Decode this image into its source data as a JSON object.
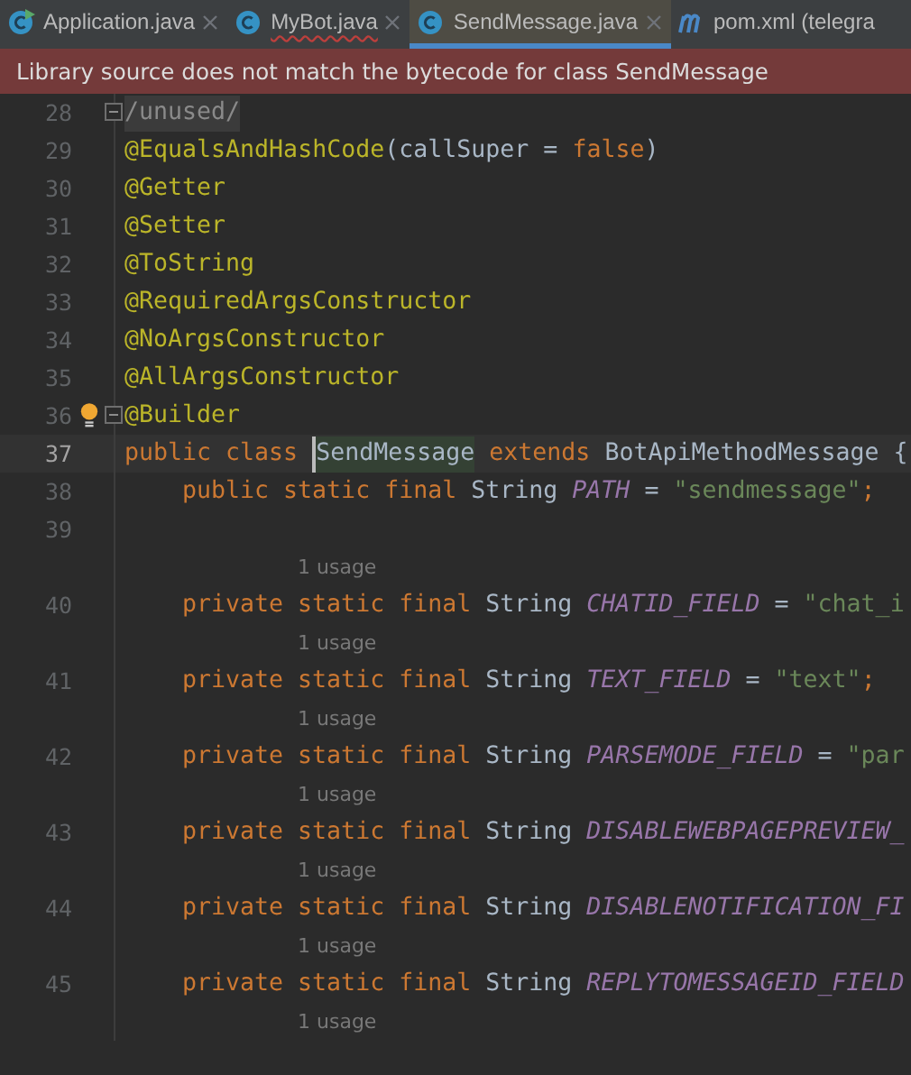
{
  "tabs": [
    {
      "label": "Application.java",
      "kind": "run",
      "selected": false,
      "closable": true,
      "error": false
    },
    {
      "label": "MyBot.java",
      "kind": "class",
      "selected": false,
      "closable": true,
      "error": true
    },
    {
      "label": "SendMessage.java",
      "kind": "class",
      "selected": true,
      "closable": true,
      "error": false
    },
    {
      "label": "pom.xml (telegra",
      "kind": "maven",
      "selected": false,
      "closable": false,
      "error": false
    }
  ],
  "banner": {
    "text": "Library source does not match the bytecode for class SendMessage"
  },
  "lines": [
    {
      "kind": "code",
      "number": "28",
      "current": false,
      "fold": true,
      "bulb": false,
      "indented": false,
      "tokens": [
        {
          "kind": "folded",
          "t": "/unused/"
        }
      ]
    },
    {
      "kind": "code",
      "number": "29",
      "current": false,
      "fold": false,
      "bulb": false,
      "indented": false,
      "tokens": [
        {
          "kind": "annotation",
          "t": "@EqualsAndHashCode"
        },
        {
          "kind": "plain",
          "t": "(callSuper = "
        },
        {
          "kind": "keyword",
          "t": "false"
        },
        {
          "kind": "plain",
          "t": ")"
        }
      ]
    },
    {
      "kind": "code",
      "number": "30",
      "current": false,
      "fold": false,
      "bulb": false,
      "indented": false,
      "tokens": [
        {
          "kind": "annotation",
          "t": "@Getter"
        }
      ]
    },
    {
      "kind": "code",
      "number": "31",
      "current": false,
      "fold": false,
      "bulb": false,
      "indented": false,
      "tokens": [
        {
          "kind": "annotation",
          "t": "@Setter"
        }
      ]
    },
    {
      "kind": "code",
      "number": "32",
      "current": false,
      "fold": false,
      "bulb": false,
      "indented": false,
      "tokens": [
        {
          "kind": "annotation",
          "t": "@ToString"
        }
      ]
    },
    {
      "kind": "code",
      "number": "33",
      "current": false,
      "fold": false,
      "bulb": false,
      "indented": false,
      "tokens": [
        {
          "kind": "annotation",
          "t": "@RequiredArgsConstructor"
        }
      ]
    },
    {
      "kind": "code",
      "number": "34",
      "current": false,
      "fold": false,
      "bulb": false,
      "indented": false,
      "tokens": [
        {
          "kind": "annotation",
          "t": "@NoArgsConstructor"
        }
      ]
    },
    {
      "kind": "code",
      "number": "35",
      "current": false,
      "fold": false,
      "bulb": false,
      "indented": false,
      "tokens": [
        {
          "kind": "annotation",
          "t": "@AllArgsConstructor"
        }
      ]
    },
    {
      "kind": "code",
      "number": "36",
      "current": false,
      "fold": true,
      "bulb": true,
      "indented": false,
      "tokens": [
        {
          "kind": "annotation",
          "t": "@Builder"
        }
      ]
    },
    {
      "kind": "code",
      "number": "37",
      "current": true,
      "fold": false,
      "bulb": false,
      "indented": false,
      "tokens": [
        {
          "kind": "keyword",
          "t": "public class "
        },
        {
          "kind": "plain",
          "t": "SendMessage",
          "highlight": true,
          "caret": true
        },
        {
          "kind": "keyword",
          "t": " extends "
        },
        {
          "kind": "plain",
          "t": "BotApiMethodMessage {"
        }
      ]
    },
    {
      "kind": "code",
      "number": "38",
      "current": false,
      "fold": false,
      "bulb": false,
      "indented": true,
      "tokens": [
        {
          "kind": "keyword",
          "t": "public static final "
        },
        {
          "kind": "plain",
          "t": "String "
        },
        {
          "kind": "constant",
          "t": "PATH"
        },
        {
          "kind": "plain",
          "t": " = "
        },
        {
          "kind": "string",
          "t": "\"sendmessage\""
        },
        {
          "kind": "keyword",
          "t": ";"
        }
      ]
    },
    {
      "kind": "code",
      "number": "39",
      "current": false,
      "fold": false,
      "bulb": false
    },
    {
      "kind": "hint",
      "text": "1 usage"
    },
    {
      "kind": "code",
      "number": "40",
      "current": false,
      "fold": false,
      "bulb": false,
      "indented": true,
      "tokens": [
        {
          "kind": "keyword",
          "t": "private static final "
        },
        {
          "kind": "plain",
          "t": "String "
        },
        {
          "kind": "constant",
          "t": "CHATID_FIELD"
        },
        {
          "kind": "plain",
          "t": " = "
        },
        {
          "kind": "string",
          "t": "\"chat_i"
        }
      ]
    },
    {
      "kind": "hint",
      "text": "1 usage"
    },
    {
      "kind": "code",
      "number": "41",
      "current": false,
      "fold": false,
      "bulb": false,
      "indented": true,
      "tokens": [
        {
          "kind": "keyword",
          "t": "private static final "
        },
        {
          "kind": "plain",
          "t": "String "
        },
        {
          "kind": "constant",
          "t": "TEXT_FIELD"
        },
        {
          "kind": "plain",
          "t": " = "
        },
        {
          "kind": "string",
          "t": "\"text\""
        },
        {
          "kind": "keyword",
          "t": ";"
        }
      ]
    },
    {
      "kind": "hint",
      "text": "1 usage"
    },
    {
      "kind": "code",
      "number": "42",
      "current": false,
      "fold": false,
      "bulb": false,
      "indented": true,
      "tokens": [
        {
          "kind": "keyword",
          "t": "private static final "
        },
        {
          "kind": "plain",
          "t": "String "
        },
        {
          "kind": "constant",
          "t": "PARSEMODE_FIELD"
        },
        {
          "kind": "plain",
          "t": " = "
        },
        {
          "kind": "string",
          "t": "\"par"
        }
      ]
    },
    {
      "kind": "hint",
      "text": "1 usage"
    },
    {
      "kind": "code",
      "number": "43",
      "current": false,
      "fold": false,
      "bulb": false,
      "indented": true,
      "tokens": [
        {
          "kind": "keyword",
          "t": "private static final "
        },
        {
          "kind": "plain",
          "t": "String "
        },
        {
          "kind": "constant",
          "t": "DISABLEWEBPAGEPREVIEW_"
        }
      ]
    },
    {
      "kind": "hint",
      "text": "1 usage"
    },
    {
      "kind": "code",
      "number": "44",
      "current": false,
      "fold": false,
      "bulb": false,
      "indented": true,
      "tokens": [
        {
          "kind": "keyword",
          "t": "private static final "
        },
        {
          "kind": "plain",
          "t": "String "
        },
        {
          "kind": "constant",
          "t": "DISABLENOTIFICATION_FI"
        }
      ]
    },
    {
      "kind": "hint",
      "text": "1 usage"
    },
    {
      "kind": "code",
      "number": "45",
      "current": false,
      "fold": false,
      "bulb": false,
      "indented": true,
      "tokens": [
        {
          "kind": "keyword",
          "t": "private static final "
        },
        {
          "kind": "plain",
          "t": "String "
        },
        {
          "kind": "constant",
          "t": "REPLYTOMESSAGEID_FIELD"
        }
      ]
    },
    {
      "kind": "hint",
      "text": "1 usage"
    }
  ]
}
